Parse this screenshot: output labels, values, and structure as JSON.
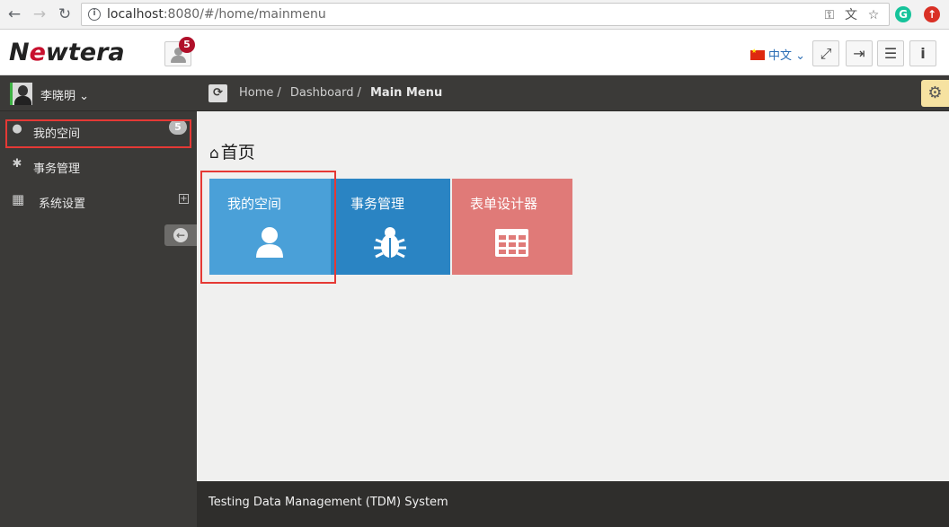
{
  "browser": {
    "url_host": "localhost",
    "url_rest": ":8080/#/home/mainmenu"
  },
  "header": {
    "logo": {
      "prefix": "N",
      "accent": "e",
      "suffix": "wtera"
    },
    "notification_count": "5",
    "language": "中文"
  },
  "sidebar": {
    "username": "李晓明",
    "items": [
      {
        "label": "我的空间",
        "icon": "user-icon",
        "badge": "5"
      },
      {
        "label": "事务管理",
        "icon": "bug-icon"
      },
      {
        "label": "系统设置",
        "icon": "building-icon"
      }
    ]
  },
  "breadcrumb": {
    "items": [
      "Home",
      "Dashboard"
    ],
    "current": "Main Menu"
  },
  "main": {
    "title": "首页",
    "tiles": [
      {
        "label": "我的空间",
        "icon": "user-icon",
        "color": "#4aa0d8"
      },
      {
        "label": "事务管理",
        "icon": "bug-icon",
        "color": "#2a84c3"
      },
      {
        "label": "表单设计器",
        "icon": "table-icon",
        "color": "#e07a78"
      }
    ]
  },
  "footer": {
    "text": "Testing Data Management (TDM) System"
  },
  "colors": {
    "sidebar_bg": "#3b3a38",
    "highlight": "#e53935",
    "notification_badge": "#b0102a"
  }
}
